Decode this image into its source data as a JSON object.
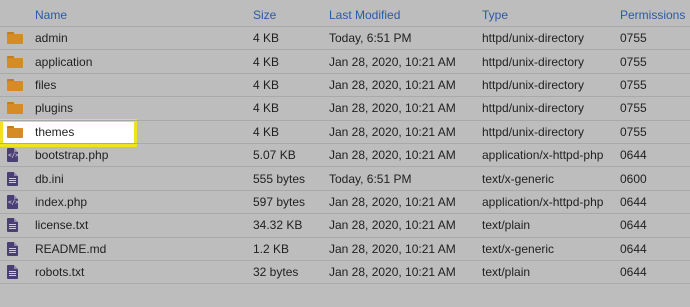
{
  "columns": {
    "name": "Name",
    "size": "Size",
    "modified": "Last Modified",
    "type": "Type",
    "permissions": "Permissions"
  },
  "rows": [
    {
      "icon": "folder-icon",
      "name": "admin",
      "size": "4 KB",
      "modified": "Today, 6:51 PM",
      "type": "httpd/unix-directory",
      "perm": "0755"
    },
    {
      "icon": "folder-icon",
      "name": "application",
      "size": "4 KB",
      "modified": "Jan 28, 2020, 10:21 AM",
      "type": "httpd/unix-directory",
      "perm": "0755"
    },
    {
      "icon": "folder-icon",
      "name": "files",
      "size": "4 KB",
      "modified": "Jan 28, 2020, 10:21 AM",
      "type": "httpd/unix-directory",
      "perm": "0755"
    },
    {
      "icon": "folder-icon",
      "name": "plugins",
      "size": "4 KB",
      "modified": "Jan 28, 2020, 10:21 AM",
      "type": "httpd/unix-directory",
      "perm": "0755"
    },
    {
      "icon": "folder-icon",
      "name": "themes",
      "size": "4 KB",
      "modified": "Jan 28, 2020, 10:21 AM",
      "type": "httpd/unix-directory",
      "perm": "0755"
    },
    {
      "icon": "code-file-icon",
      "name": "bootstrap.php",
      "size": "5.07 KB",
      "modified": "Jan 28, 2020, 10:21 AM",
      "type": "application/x-httpd-php",
      "perm": "0644"
    },
    {
      "icon": "text-file-icon",
      "name": "db.ini",
      "size": "555 bytes",
      "modified": "Today, 6:51 PM",
      "type": "text/x-generic",
      "perm": "0600"
    },
    {
      "icon": "code-file-icon",
      "name": "index.php",
      "size": "597 bytes",
      "modified": "Jan 28, 2020, 10:21 AM",
      "type": "application/x-httpd-php",
      "perm": "0644"
    },
    {
      "icon": "text-file-icon",
      "name": "license.txt",
      "size": "34.32 KB",
      "modified": "Jan 28, 2020, 10:21 AM",
      "type": "text/plain",
      "perm": "0644"
    },
    {
      "icon": "text-file-icon",
      "name": "README.md",
      "size": "1.2 KB",
      "modified": "Jan 28, 2020, 10:21 AM",
      "type": "text/x-generic",
      "perm": "0644"
    },
    {
      "icon": "text-file-icon",
      "name": "robots.txt",
      "size": "32 bytes",
      "modified": "Jan 28, 2020, 10:21 AM",
      "type": "text/plain",
      "perm": "0644"
    }
  ],
  "colors": {
    "header_text": "#2b5aa6",
    "folder": "#d68b25",
    "file": "#4a3f73",
    "highlight_border": "#f3e21a"
  }
}
